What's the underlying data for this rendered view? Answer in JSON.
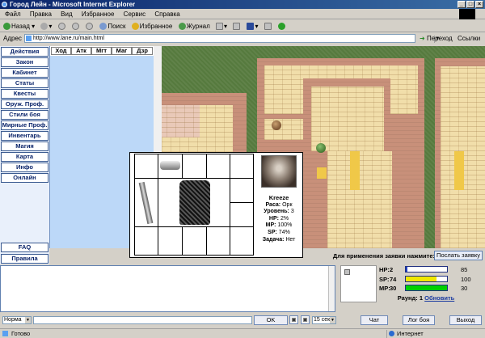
{
  "window": {
    "title": "Город Лейн - Microsoft Internet Explorer"
  },
  "menu": [
    "Файл",
    "Правка",
    "Вид",
    "Избранное",
    "Сервис",
    "Справка"
  ],
  "toolbar": {
    "back": "Назад",
    "search": "Поиск",
    "favorites": "Избранное",
    "journal": "Журнал"
  },
  "address": {
    "label": "Адрес",
    "url": "http://www.lane.ru/main.html",
    "go": "Переход",
    "links": "Ссылки"
  },
  "sidebar": {
    "items": [
      "Действия",
      "Закон",
      "Кабинет",
      "Статы",
      "Квесты",
      "Оруж. Проф.",
      "Стили боя",
      "Мирные Проф.",
      "Инвентарь",
      "Магия",
      "Карта",
      "Инфо",
      "Онлайн"
    ],
    "faq": "FAQ",
    "rules": "Правила"
  },
  "tabs": [
    "Ход",
    "Атк",
    "Мгт",
    "Маг",
    "Дзр"
  ],
  "character": {
    "name": "Kreeze",
    "race_label": "Раса:",
    "race": "Орк",
    "level_label": "Уровень:",
    "level": "3",
    "hp_label": "HP:",
    "hp": "2%",
    "mp_label": "MP:",
    "mp": "100%",
    "sp_label": "SP:",
    "sp": "74%",
    "task_label": "Задача:",
    "task": "Нет"
  },
  "order": {
    "prompt": "Для применения заявки нажмите:",
    "button": "Послать заявку"
  },
  "bars": [
    {
      "label": "HP:",
      "value": "2",
      "max": "85",
      "fraction": 0.03,
      "color": "#2040c0"
    },
    {
      "label": "SP:",
      "value": "74",
      "max": "100",
      "fraction": 0.74,
      "color": "#f0e800"
    },
    {
      "label": "MP:",
      "value": "30",
      "max": "30",
      "fraction": 1.0,
      "color": "#00d000"
    }
  ],
  "round": {
    "label": "Раунд:",
    "value": "1",
    "refresh": "Обновить"
  },
  "bottom": {
    "mode": "Норма",
    "ok": "OK",
    "timer": "15 сек",
    "chat": "Чат",
    "fight_log": "Лог боя",
    "exit": "Выход"
  },
  "status": {
    "left": "Готово",
    "zone": "Интернет"
  }
}
